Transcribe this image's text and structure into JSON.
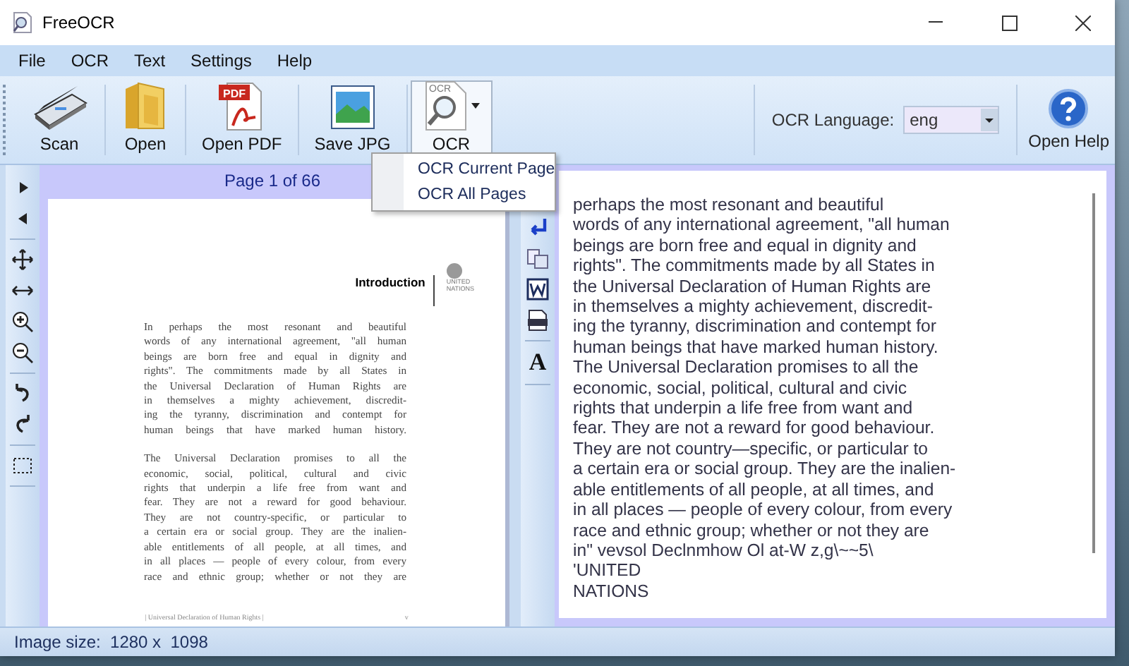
{
  "window": {
    "title": "FreeOCR"
  },
  "menu_bar": [
    "File",
    "OCR",
    "Text",
    "Settings",
    "Help"
  ],
  "toolbar": {
    "buttons": [
      {
        "label": "Scan",
        "selected": false
      },
      {
        "label": "Open",
        "selected": false
      },
      {
        "label": "Open PDF",
        "selected": false
      },
      {
        "label": "Save JPG",
        "selected": false
      },
      {
        "label": "OCR",
        "selected": true
      }
    ],
    "ocr_icon_text": "OCR",
    "pdf_icon_text": "PDF",
    "language": {
      "label": "OCR Language:",
      "value": "eng"
    },
    "help": {
      "label": "Open Help"
    }
  },
  "dropdown_menu": [
    "OCR Current Page",
    "OCR All Pages"
  ],
  "image_pane": {
    "page_label": "Page 1 of 66",
    "document": {
      "heading": "Introduction",
      "logo_text": [
        "UNITED",
        "NATIONS"
      ],
      "paragraphs": [
        [
          "In perhaps the most resonant and beautiful",
          "words of any international agreement, \"all human",
          "beings are born free and equal in dignity and",
          "rights\". The commitments made by all States in",
          "the Universal Declaration of Human Rights are",
          "in themselves a mighty achievement, discredit-",
          "ing the tyranny, discrimination and contempt for",
          "human beings that have marked human history."
        ],
        [
          "The Universal Declaration promises to all the",
          "economic, social, political, cultural and civic",
          "rights that underpin a life free from want and",
          "fear. They are not a reward for good behaviour.",
          "They are not country-specific, or particular to",
          "a certain era or social group. They are the inalien-",
          "able entitlements of all people, at all times, and",
          "in all places — people of every colour, from every",
          "race and ethnic group; whether or not they are"
        ]
      ],
      "footer": "| Universal Declaration of Human Rights |",
      "page_number": "v"
    }
  },
  "text_tools": {
    "font_button": "A"
  },
  "ocr_text": [
    "perhaps the most resonant and beautiful",
    "words of any international agreement, \"all human",
    "beings are born free and equal in dignity and",
    "rights\". The commitments made by all States in",
    "the Universal Declaration of Human Rights are",
    "in themselves a mighty achievement, discredit-",
    "ing the tyranny, discrimination and contempt for",
    "human beings that have marked human history.",
    "The Universal Declaration promises to all the",
    "economic, social, political, cultural and civic",
    "rights that underpin a life free from want and",
    "fear. They are not a reward for good behaviour.",
    "They are not country—specific, or particular to",
    "a certain era or social group. They are the inalien-",
    "able entitlements of all people, at all times, and",
    "in all places — people of every colour, from every",
    "race and ethnic group; whether or not they are",
    "in\" vevsol Declnmhow Ol at-W z,g\\~~5\\",
    "'UNITED",
    "NATIONS"
  ],
  "status_bar": {
    "image_size": "Image size:  1280 x  1098"
  }
}
